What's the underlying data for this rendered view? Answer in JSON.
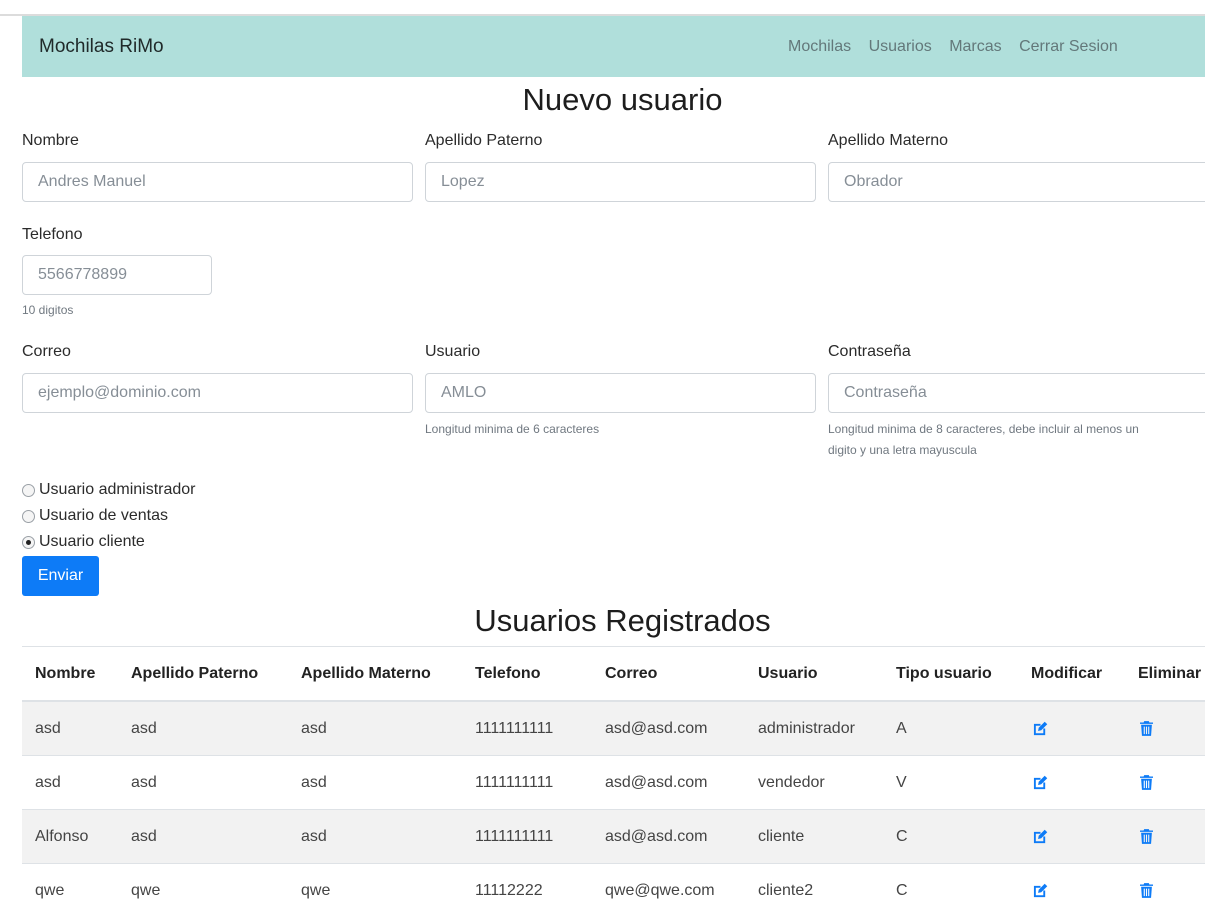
{
  "navbar": {
    "brand": "Mochilas RiMo",
    "links": [
      "Mochilas",
      "Usuarios",
      "Marcas",
      "Cerrar Sesion"
    ]
  },
  "form": {
    "title": "Nuevo usuario",
    "nombre": {
      "label": "Nombre",
      "placeholder": "Andres Manuel"
    },
    "apellido_paterno": {
      "label": "Apellido Paterno",
      "placeholder": "Lopez"
    },
    "apellido_materno": {
      "label": "Apellido Materno",
      "placeholder": "Obrador"
    },
    "telefono": {
      "label": "Telefono",
      "placeholder": "5566778899",
      "help": "10 digitos"
    },
    "correo": {
      "label": "Correo",
      "placeholder": "ejemplo@dominio.com"
    },
    "usuario": {
      "label": "Usuario",
      "placeholder": "AMLO",
      "help": "Longitud minima de 6 caracteres"
    },
    "contrasena": {
      "label": "Contraseña",
      "placeholder": "Contraseña",
      "help_line1": "Longitud minima de 8 caracteres, debe incluir al menos un",
      "help_line2": "digito y una letra mayuscula"
    },
    "radios": [
      {
        "label": "Usuario administrador",
        "checked": false
      },
      {
        "label": "Usuario de ventas",
        "checked": false
      },
      {
        "label": "Usuario cliente",
        "checked": true
      }
    ],
    "submit_label": "Enviar"
  },
  "table": {
    "title": "Usuarios Registrados",
    "headers": [
      "Nombre",
      "Apellido Paterno",
      "Apellido Materno",
      "Telefono",
      "Correo",
      "Usuario",
      "Tipo usuario",
      "Modificar",
      "Eliminar"
    ],
    "rows": [
      [
        "asd",
        "asd",
        "asd",
        "1111111111",
        "asd@asd.com",
        "administrador",
        "A"
      ],
      [
        "asd",
        "asd",
        "asd",
        "1111111111",
        "asd@asd.com",
        "vendedor",
        "V"
      ],
      [
        "Alfonso",
        "asd",
        "asd",
        "1111111111",
        "asd@asd.com",
        "cliente",
        "C"
      ],
      [
        "qwe",
        "qwe",
        "qwe",
        "11112222",
        "qwe@qwe.com",
        "cliente2",
        "C"
      ]
    ],
    "edit_icon": "edit-icon",
    "delete_icon": "trash-icon",
    "icon_color": "#0d7bf7"
  }
}
